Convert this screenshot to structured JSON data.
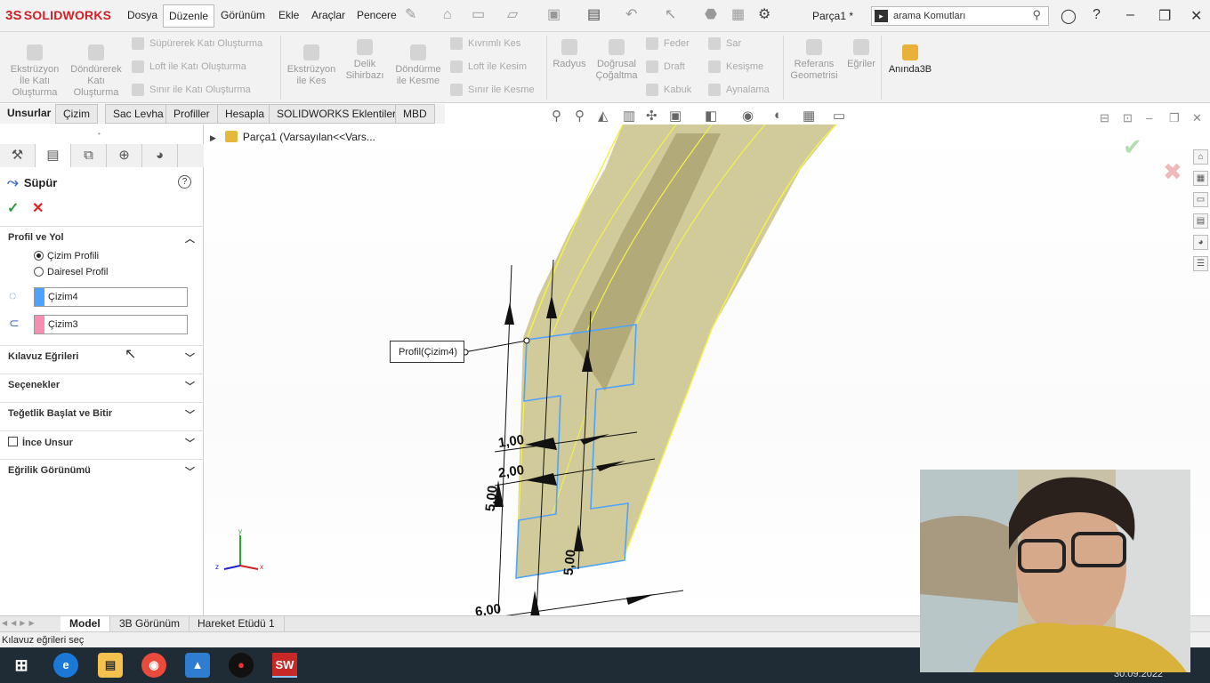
{
  "app": {
    "brand": "SOLIDWORKS",
    "logo_prefix": "3S",
    "document_title": "Parça1 *"
  },
  "menu": [
    "Dosya",
    "Düzenle",
    "Görünüm",
    "Ekle",
    "Araçlar",
    "Pencere"
  ],
  "search": {
    "placeholder": "arama Komutları"
  },
  "ribbon": {
    "big": [
      {
        "label": "Ekstrüzyon İle Katı Oluşturma",
        "lines": [
          "Ekstrüzyon",
          "İle Katı",
          "Oluşturma"
        ]
      },
      {
        "label": "Döndürerek Katı Oluşturma",
        "lines": [
          "Döndürerek",
          "Katı",
          "Oluşturma"
        ]
      },
      {
        "label": "Ekstrüzyon ile Kes",
        "lines": [
          "Ekstrüzyon",
          "ile Kes"
        ]
      },
      {
        "label": "Delik Sihirbazı",
        "lines": [
          "Delik",
          "Sihirbazı"
        ]
      },
      {
        "label": "Döndürme ile Kesme",
        "lines": [
          "Döndürme",
          "ile Kesme"
        ]
      },
      {
        "label": "Radyus",
        "lines": [
          "Radyus"
        ]
      },
      {
        "label": "Doğrusal Çoğaltma",
        "lines": [
          "Doğrusal",
          "Çoğaltma"
        ]
      },
      {
        "label": "Referans Geometrisi",
        "lines": [
          "Referans",
          "Geometrisi"
        ]
      },
      {
        "label": "Eğriler",
        "lines": [
          "Eğriler"
        ]
      },
      {
        "label": "Anında3B",
        "lines": [
          "Anında3B"
        ]
      }
    ],
    "small": [
      "Süpürerek Katı Oluşturma",
      "Loft ile Katı Oluşturma",
      "Sınır ile Katı Oluşturma",
      "Kıvrımlı Kes",
      "Loft ile Kesim",
      "Sınır ile Kesme",
      "Feder",
      "Draft",
      "Kabuk",
      "Sar",
      "Kesişme",
      "Aynalama"
    ]
  },
  "command_tabs": [
    "Unsurlar",
    "Çizim",
    "Sac Levha",
    "Profiller",
    "Hesapla",
    "SOLIDWORKS Eklentileri",
    "MBD"
  ],
  "property_manager": {
    "title": "Süpür",
    "help": "?",
    "sections": {
      "profile_path": "Profil ve Yol",
      "guide_curves": "Kılavuz Eğrileri",
      "options": "Seçenekler",
      "tangency": "Teğetlik Başlat ve Bitir",
      "thin_feature": "İnce Unsur",
      "curvature": "Eğrilik Görünümü"
    },
    "radio": {
      "sketch_profile": "Çizim Profili",
      "circular_profile": "Dairesel Profil",
      "selected": "sketch_profile"
    },
    "profile_field": "Çizim4",
    "path_field": "Çizim3",
    "profile_color": "#4da3ff",
    "path_color": "#f48fb1"
  },
  "tree": {
    "root": "Parça1  (Varsayılan<<Vars..."
  },
  "viewport": {
    "callout": "Profil(Çizim4)",
    "dimensions": [
      "1,00",
      "2,00",
      "5,00",
      "5,00",
      "6,00"
    ]
  },
  "bottom_tabs": [
    "Model",
    "3B Görünüm",
    "Hareket Etüdü 1"
  ],
  "status": "Kılavuz eğrileri seç",
  "clock": "30.09.2022",
  "taskbar_apps": [
    "start-icon",
    "edge-icon",
    "file-explorer-icon",
    "chrome-icon",
    "photos-icon",
    "recorder-icon",
    "solidworks-icon"
  ]
}
